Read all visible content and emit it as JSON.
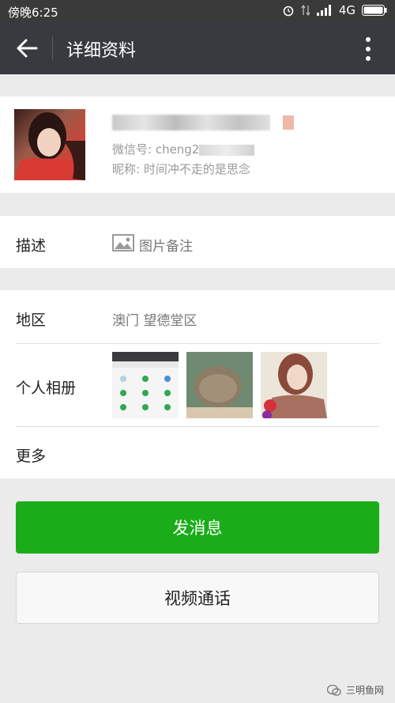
{
  "status_bar": {
    "time": "傍晚6:25",
    "network": "4G"
  },
  "nav": {
    "title": "详细资料"
  },
  "profile": {
    "wechat_id_prefix": "微信号: cheng2",
    "nickname": "昵称: 时间冲不走的是思念"
  },
  "rows": {
    "description_label": "描述",
    "description_value": "图片备注",
    "region_label": "地区",
    "region_value": "澳门  望德堂区",
    "album_label": "个人相册",
    "more_label": "更多"
  },
  "buttons": {
    "send_message": "发消息",
    "video_call": "视频通话"
  },
  "watermark": "三明鱼网",
  "colors": {
    "accent": "#1aad19",
    "navbar": "#393a3f"
  }
}
